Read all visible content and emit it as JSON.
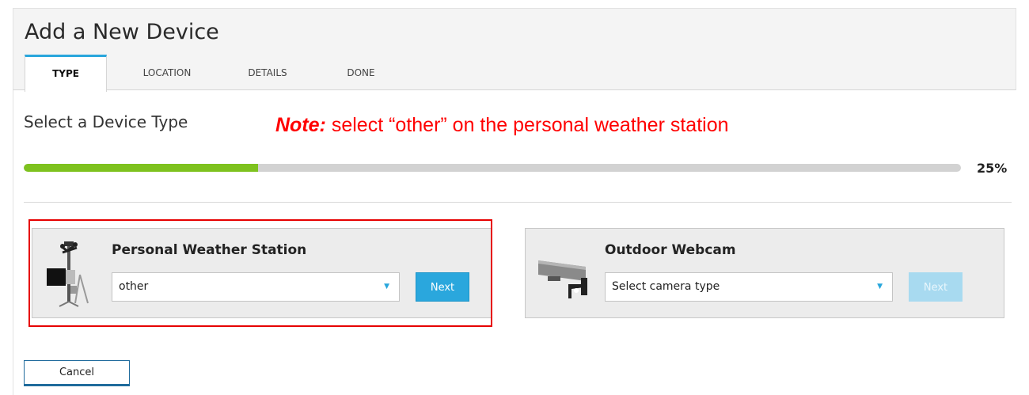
{
  "header": {
    "title": "Add a New Device",
    "tabs": [
      {
        "label": "TYPE",
        "active": true
      },
      {
        "label": "LOCATION",
        "active": false
      },
      {
        "label": "DETAILS",
        "active": false
      },
      {
        "label": "DONE",
        "active": false
      }
    ]
  },
  "main": {
    "subtitle": "Select a Device Type",
    "note_bold": "Note:",
    "note_text": " select “other” on the personal weather station",
    "progress": {
      "value_percent": 25,
      "label": "25%"
    }
  },
  "cards": {
    "weather": {
      "title": "Personal Weather Station",
      "select_value": "other",
      "next_label": "Next",
      "next_enabled": true,
      "icon": "weather-station-icon"
    },
    "webcam": {
      "title": "Outdoor Webcam",
      "select_value": "Select camera type",
      "next_label": "Next",
      "next_enabled": false,
      "icon": "security-camera-icon"
    }
  },
  "footer": {
    "cancel_label": "Cancel"
  },
  "colors": {
    "accent": "#2aa7dd",
    "progress_fill": "#7ec21f",
    "note": "#ff0000",
    "highlight": "#e60000"
  }
}
